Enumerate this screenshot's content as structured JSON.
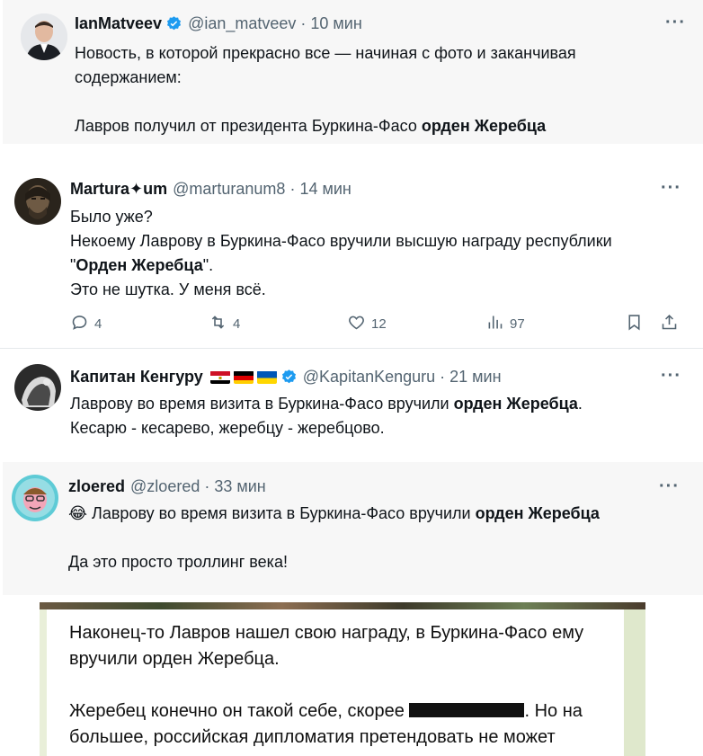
{
  "tweets": [
    {
      "name": "IanMatveev",
      "handle": "@ian_matveev",
      "separator": "·",
      "time": "10 мин",
      "more": "···",
      "lines": [
        "Новость, в которой прекрасно все — начиная с фото и заканчивая",
        "содержанием:",
        "Лавров получил от президента Буркина-Фасо ",
        "орден Жеребца"
      ]
    },
    {
      "name": "Martura✦um",
      "handle": "@marturanum8",
      "separator": "·",
      "time": "14 мин",
      "more": "···",
      "lines": [
        "Было уже?",
        "Некоему Лаврову в Буркина-Фасо вручили высшую награду республики",
        "\"",
        "Орден Жеребца",
        "\".",
        "Это не шутка. У меня всё."
      ],
      "actions": {
        "replies": "4",
        "retweets": "4",
        "likes": "12",
        "views": "97"
      }
    },
    {
      "name": "Капитан Кенгуру",
      "handle": "@KapitanKenguru",
      "separator": "·",
      "time": "21 мин",
      "more": "···",
      "lines": [
        "Лаврову во время визита в Буркина-Фасо вручили ",
        "орден Жеребца",
        ".",
        "Кесарю - кесарево, жеребцу - жеребцово."
      ]
    },
    {
      "name": "zloered",
      "handle": "@zloered",
      "separator": "·",
      "time": "33 мин",
      "more": "···",
      "emoji": "😂",
      "lines": [
        " Лаврову во время визита в Буркина-Фасо вручили ",
        "орден Жеребца",
        "Да это просто троллинг века!"
      ]
    }
  ],
  "telegram": {
    "lines": [
      "Наконец-то Лавров нашел свою награду, в Буркина-Фасо ему",
      "вручили орден Жеребца.",
      "Жеребец конечно он такой себе, скорее ",
      ". Но на",
      "большее, российская дипломатия претендовать не может"
    ]
  },
  "colors": {
    "verified": "#1d9bf0",
    "secondary_text": "#536471",
    "highlight_bg": "#f7f7f7"
  },
  "icons": [
    "verified-badge-icon",
    "more-icon",
    "reply-icon",
    "retweet-icon",
    "like-icon",
    "views-icon",
    "bookmark-icon",
    "share-icon"
  ]
}
